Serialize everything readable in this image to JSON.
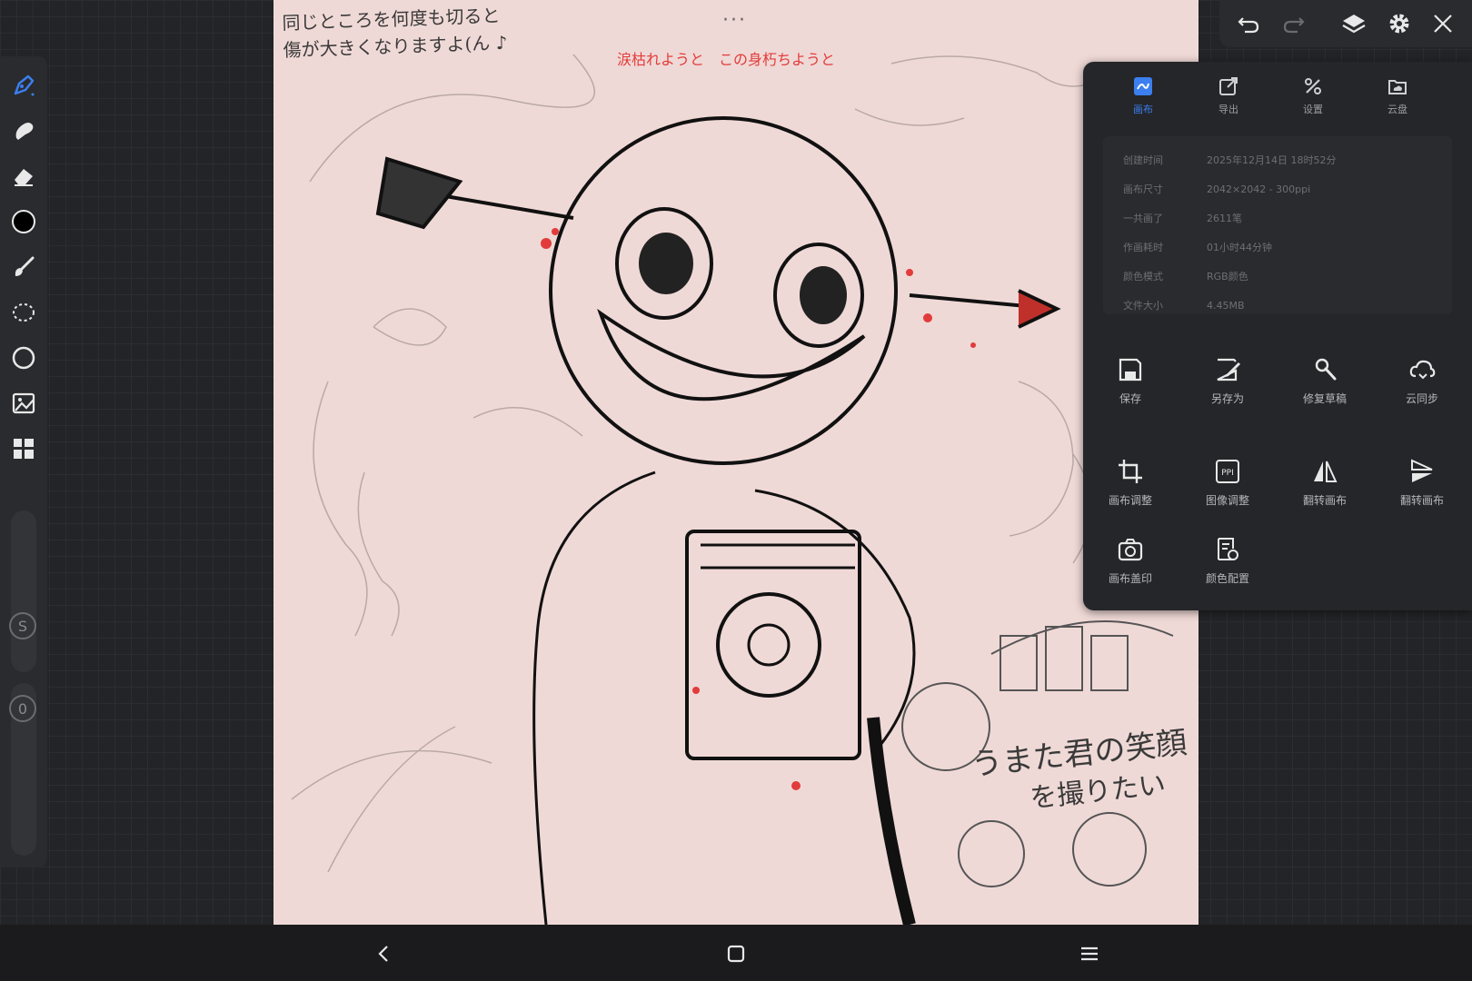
{
  "canvas": {
    "note_lines": [
      "同じところを何度も切ると",
      "傷が大きくなりますよ(ん ♪"
    ],
    "lyric": "涙枯れようと　この身朽ちようと",
    "sign_lines": [
      "うまた君の笑顔",
      "を撮りたい"
    ],
    "more": "···"
  },
  "panel": {
    "tabs": [
      {
        "label": "画布",
        "icon": "canvas-icon",
        "active": true
      },
      {
        "label": "导出",
        "icon": "export-icon",
        "active": false
      },
      {
        "label": "设置",
        "icon": "settings-tools-icon",
        "active": false
      },
      {
        "label": "云盘",
        "icon": "cloud-drive-icon",
        "active": false
      }
    ],
    "info": [
      {
        "key": "创建时间",
        "value": "2025年12月14日 18时52分"
      },
      {
        "key": "画布尺寸",
        "value": "2042×2042 - 300ppi"
      },
      {
        "key": "一共画了",
        "value": "2611笔"
      },
      {
        "key": "作画耗时",
        "value": "01小时44分钟"
      },
      {
        "key": "颜色模式",
        "value": "RGB颜色"
      },
      {
        "key": "文件大小",
        "value": "4.45MB"
      }
    ],
    "actions": [
      {
        "label": "保存",
        "icon": "save-icon"
      },
      {
        "label": "另存为",
        "icon": "save-as-icon"
      },
      {
        "label": "修复草稿",
        "icon": "repair-icon"
      },
      {
        "label": "云同步",
        "icon": "cloud-sync-icon"
      },
      {
        "label": "画布调整",
        "icon": "crop-icon"
      },
      {
        "label": "图像调整",
        "icon": "ppi-icon"
      },
      {
        "label": "翻转画布",
        "icon": "flip-horizontal-icon"
      },
      {
        "label": "翻转画布",
        "icon": "flip-vertical-icon"
      },
      {
        "label": "画布盖印",
        "icon": "camera-icon"
      },
      {
        "label": "颜色配置",
        "icon": "color-profile-icon"
      }
    ]
  },
  "left_toolbar": {
    "sliders": [
      {
        "badge": "S"
      },
      {
        "badge": "0"
      }
    ]
  },
  "colors": {
    "accent": "#3b7ff0",
    "current_color": "#000000"
  }
}
